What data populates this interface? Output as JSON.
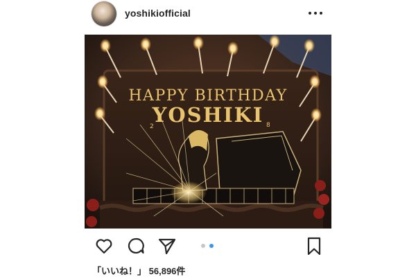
{
  "post": {
    "username": "yoshikiofficial",
    "cake_line1": "HAPPY BIRTHDAY",
    "cake_line2": "YOSHIKI",
    "image_count": 2,
    "current_image": 2,
    "likes_label": "「いいね！」",
    "likes_count": "56,896",
    "likes_suffix": "件"
  },
  "icons": {
    "more": "more-options-icon",
    "like": "heart-icon",
    "comment": "comment-bubble-icon",
    "share": "paper-plane-icon",
    "save": "bookmark-icon"
  },
  "colors": {
    "text": "#262626",
    "dot_active": "#3897f0",
    "dot_inactive": "#c7c7c7",
    "icing_gold": "#e9c46e"
  }
}
